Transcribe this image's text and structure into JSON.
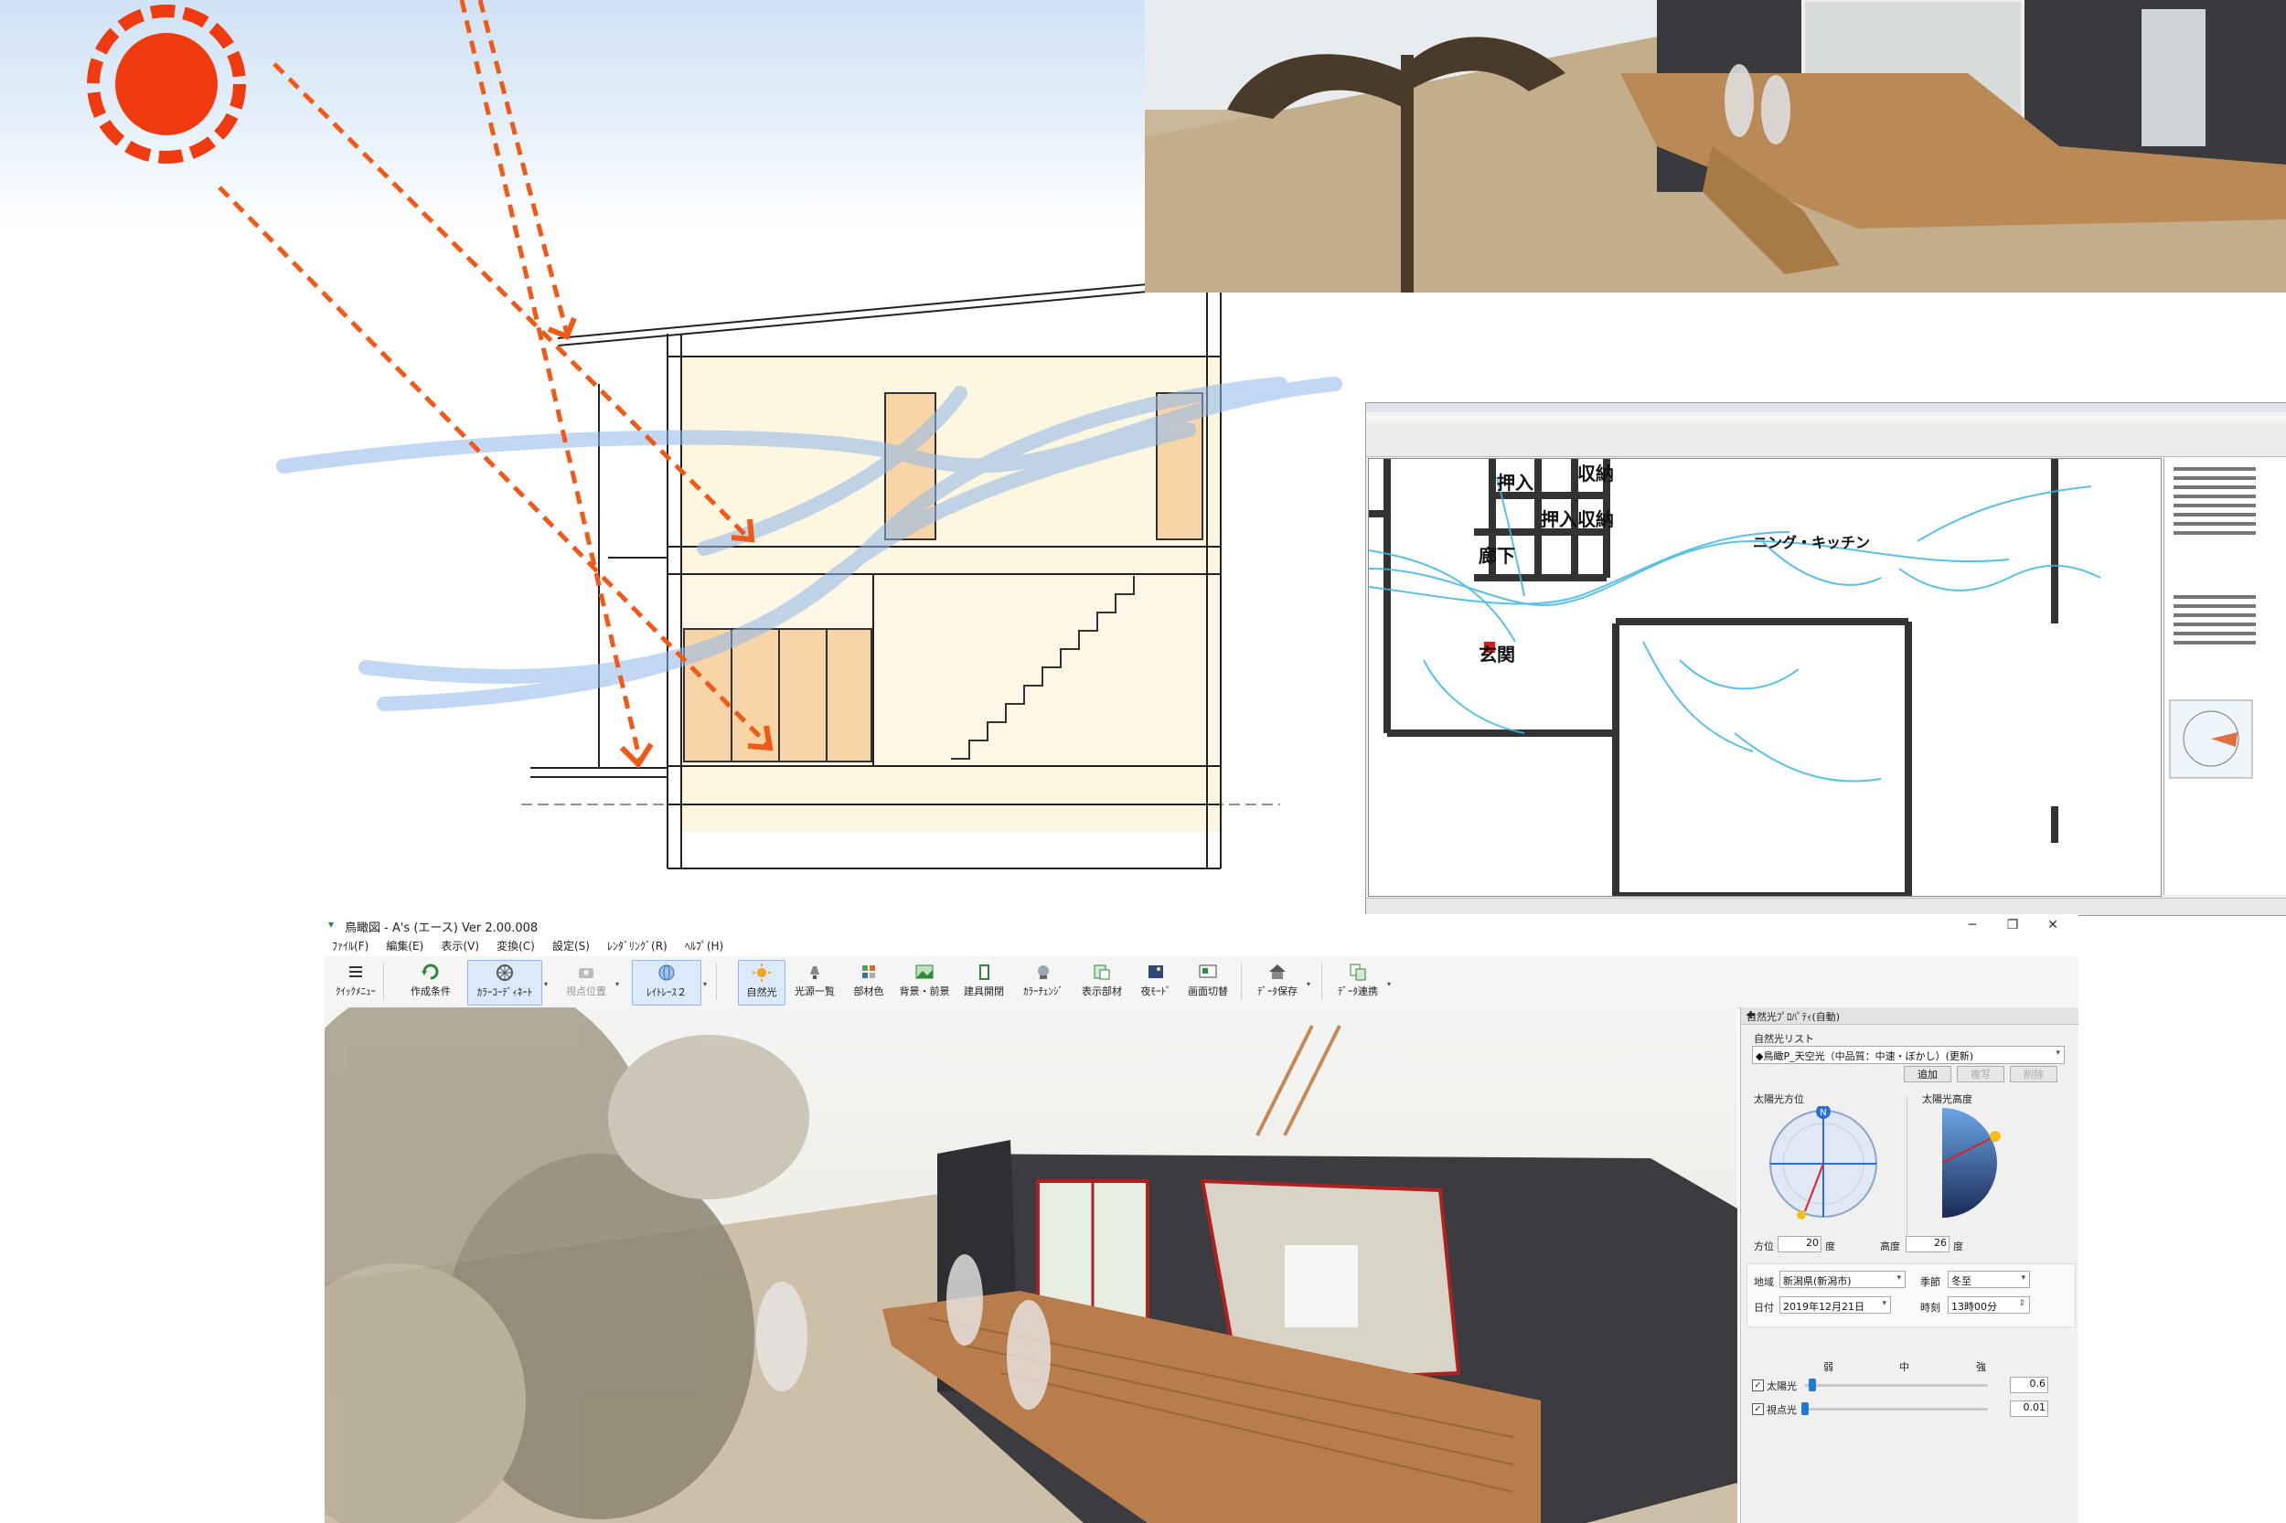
{
  "cfd": {
    "rooms": {
      "oshiire1": "押入",
      "oshiire2": "押入",
      "shuno1": "収納",
      "shuno2": "収納",
      "roka": "廊下",
      "genkan": "玄関",
      "dining": "ニング・キッチン"
    }
  },
  "app": {
    "title": "鳥瞰図 - A's (エース) Ver 2.00.008",
    "window_controls": {
      "minimize": "─",
      "maximize": "❐",
      "close": "✕"
    },
    "menu": [
      "ﾌｧｲﾙ(F)",
      "編集(E)",
      "表示(V)",
      "変換(C)",
      "設定(S)",
      "ﾚﾝﾀﾞﾘﾝｸﾞ(R)",
      "ﾍﾙﾌﾟ(H)"
    ],
    "toolbar": {
      "quick_menu": "ｸｲｯｸﾒﾆｭｰ",
      "create_conditions": "作成条件",
      "color_coordinate": "ｶﾗｰｺｰﾃﾞｨﾈｰﾄ",
      "viewpoint": "視点位置",
      "raytrace": "ﾚｲﾄﾚｰｽ２",
      "natural_light": "自然光",
      "light_list": "光源一覧",
      "material_color": "部材色",
      "background": "背景・前景",
      "fixture_open": "建具開閉",
      "color_change": "ｶﾗｰﾁｪﾝｼﾞ",
      "show_parts": "表示部材",
      "night_mode": "夜ﾓｰﾄﾞ",
      "screen_switch": "画面切替",
      "data_save": "ﾃﾞｰﾀ保存",
      "data_link": "ﾃﾞｰﾀ連携"
    }
  },
  "panel": {
    "title": "自然光ﾌﾟﾛﾊﾟﾃｨ(自動)",
    "list_label": "自然光リスト",
    "list_selected": "◆鳥瞰P_天空光（中品質：中速・ぼかし）(更新)",
    "btn_add": "追加",
    "btn_copy": "複写",
    "btn_delete": "削除",
    "azimuth_label": "太陽光方位",
    "altitude_label": "太陽光高度",
    "compass_north": "N",
    "azimuth_field_label": "方位",
    "azimuth_value": "20",
    "azimuth_unit": "度",
    "altitude_field_label": "高度",
    "altitude_value": "26",
    "altitude_unit": "度",
    "region_label": "地域",
    "region_value": "新潟県(新潟市)",
    "season_label": "季節",
    "season_value": "冬至",
    "date_label": "日付",
    "date_value": "2019年12月21日",
    "time_label": "時刻",
    "time_value": "13時00分",
    "scale_weak": "弱",
    "scale_mid": "中",
    "scale_strong": "強",
    "sunlight_label": "太陽光",
    "sunlight_value": "0.6",
    "sunlight_level": 0.04,
    "viewlight_label": "視点光",
    "viewlight_value": "0.01",
    "viewlight_level": 0.0,
    "check_mark": "✓"
  },
  "colors": {
    "sun": "#f03a10",
    "arrow": "#ef5a18",
    "wind": "#8fb8ea",
    "selected_tab": "#dbe9fb",
    "accent_blue": "#1f7ad6"
  }
}
